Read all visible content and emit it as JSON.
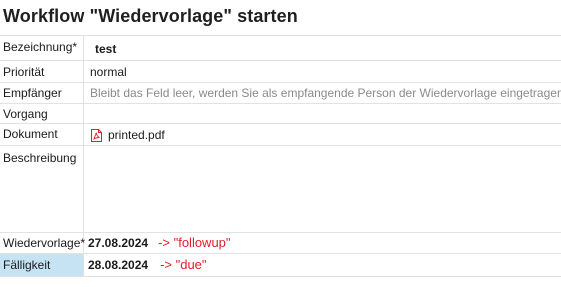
{
  "title": "Workflow \"Wiedervorlage\" starten",
  "fields": {
    "name": {
      "label": "Bezeichnung*",
      "value": "test"
    },
    "priority": {
      "label": "Priorität",
      "value": "normal"
    },
    "recipient": {
      "label": "Empfänger",
      "placeholder": "Bleibt das Feld leer, werden Sie als empfangende Person der Wiedervorlage eingetragen"
    },
    "process": {
      "label": "Vorgang",
      "value": ""
    },
    "document": {
      "label": "Dokument",
      "value": "printed.pdf",
      "icon": "pdf-file-icon"
    },
    "description": {
      "label": "Beschreibung",
      "value": ""
    },
    "followup": {
      "label": "Wiedervorlage*",
      "value": "27.08.2024",
      "annotation": "-> \"followup\""
    },
    "due": {
      "label": "Fälligkeit",
      "value": "28.08.2024",
      "annotation": "-> \"due\""
    }
  },
  "colors": {
    "annotation": "#e0202a",
    "selected_label_bg": "#c5e3f3",
    "pdf_icon": "#d9262c"
  }
}
